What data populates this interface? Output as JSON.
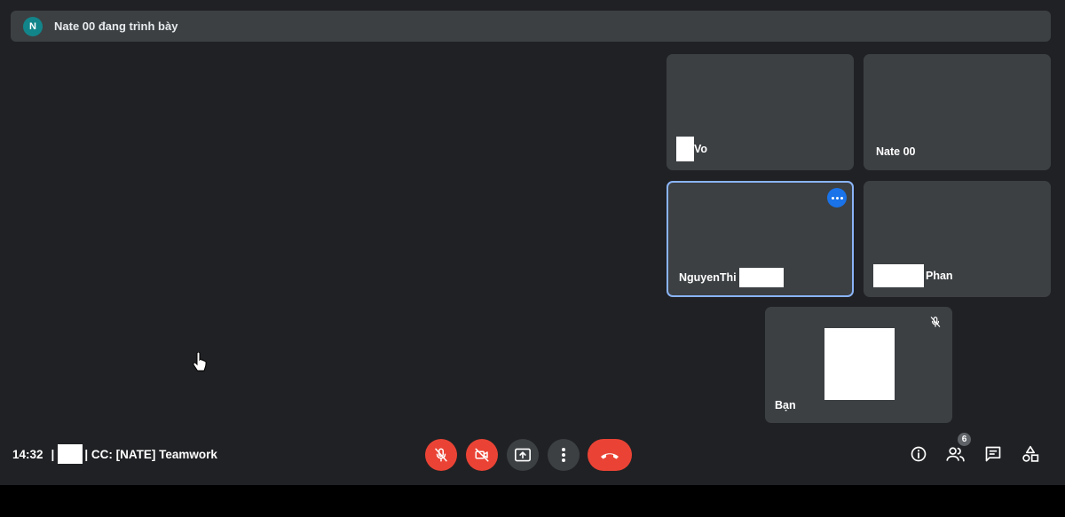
{
  "banner": {
    "avatar_letter": "N",
    "text": "Nate 00 đang trình bày"
  },
  "tiles": [
    {
      "id": "vo",
      "name": "Vo"
    },
    {
      "id": "nate",
      "name": "Nate 00"
    },
    {
      "id": "nguyenthi",
      "name": "NguyenThi",
      "active": true
    },
    {
      "id": "phan",
      "name": "Phan"
    },
    {
      "id": "ban",
      "name": "Bạn",
      "muted": true
    }
  ],
  "meeting": {
    "time": "14:32",
    "separator": "|",
    "title": "| CC: [NATE] Teamwork"
  },
  "controls": {
    "mic": "mic-off-icon",
    "camera": "camera-off-icon",
    "present": "present-screen-icon",
    "more": "more-options-icon",
    "hangup": "hangup-icon"
  },
  "right_controls": {
    "people_count": "6"
  },
  "colors": {
    "background": "#202124",
    "tile": "#3c4043",
    "accent_red": "#ea4335",
    "active_border": "#8ab4f8",
    "avatar": "#12858a"
  }
}
